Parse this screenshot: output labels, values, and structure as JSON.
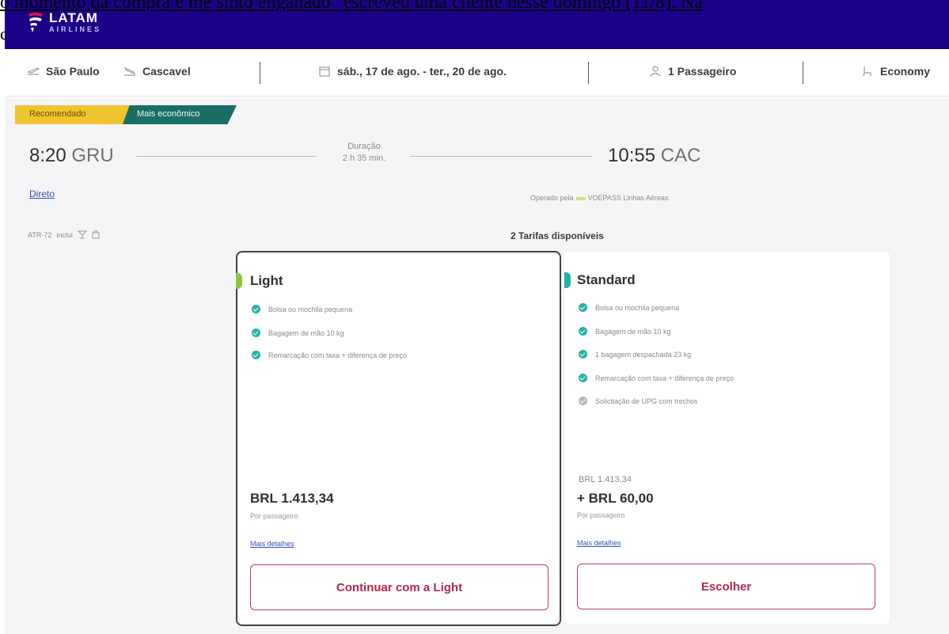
{
  "article": {
    "caption_line": "o momento da compra e me sinto enganado\" escreveu uma cliente nesse domingo (11/8). Na",
    "left_fragment": "c"
  },
  "header": {
    "logo_text": "LATAM",
    "logo_sub": "AIRLINES",
    "brand_color": "#1b0088"
  },
  "search": {
    "origin": "São Paulo",
    "destination": "Cascavel",
    "dates": "sáb., 17 de ago. - ter., 20 de ago.",
    "passengers": "1 Passageiro",
    "cabin": "Economy"
  },
  "flight": {
    "tags": [
      "Recomendado",
      "Mais econômico"
    ],
    "dep_time": "8:20",
    "dep_airport": "GRU",
    "duration_label": "Duração",
    "duration": "2 h 35 min.",
    "arr_time": "10:55",
    "arr_airport": "CAC",
    "stops": "Direto",
    "operated_label": "Operado pela",
    "operator": "VOEPASS Linhas Aéreas",
    "aircraft": "ATR-72",
    "aircraft_includes": "inclui"
  },
  "fares": {
    "title": "2 Tarifas disponíveis",
    "light": {
      "name": "Light",
      "pill_color": "#8cc63f",
      "features": [
        {
          "text": "Bolsa ou mochila pequena",
          "included": true
        },
        {
          "text": "Bagagem de mão 10 kg",
          "included": true
        },
        {
          "text": "Remarcação com taxa + diferença de preço",
          "included": true
        }
      ],
      "price": "BRL 1.413,34",
      "per": "Por passageiro",
      "details": "Mais detalhes",
      "button": "Continuar com a Light"
    },
    "standard": {
      "name": "Standard",
      "pill_color": "#1fb3a6",
      "features": [
        {
          "text": "Bolsa ou mochila pequena",
          "included": true
        },
        {
          "text": "Bagagem de mão 10 kg",
          "included": true
        },
        {
          "text": "1 bagagem despachada 23 kg",
          "included": true
        },
        {
          "text": "Remarcação com taxa + diferença de preço",
          "included": true
        },
        {
          "text": "Solicitação de UPG com trechos",
          "included": false
        }
      ],
      "base_price": "BRL 1.413,34",
      "price": "+ BRL 60,00",
      "per": "Por passageiro",
      "details": "Mais detalhes",
      "button": "Escolher"
    }
  }
}
